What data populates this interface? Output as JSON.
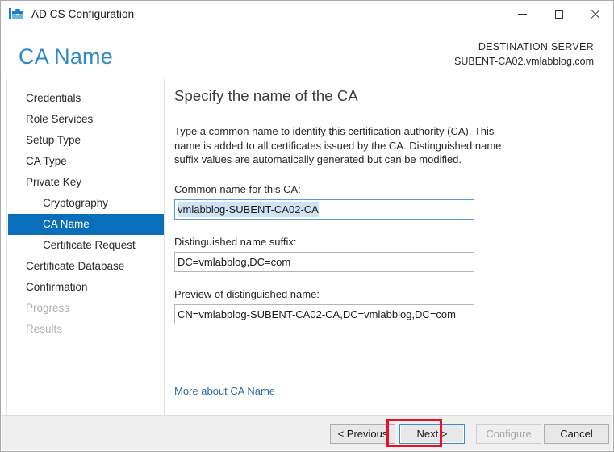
{
  "window": {
    "title": "AD CS Configuration",
    "icon": "server-manager-icon",
    "minimize_label": "Minimize",
    "maximize_label": "Maximize",
    "close_label": "Close"
  },
  "header": {
    "page_title": "CA Name",
    "destination_label": "DESTINATION SERVER",
    "destination_server": "SUBENT-CA02.vmlabblog.com",
    "accent_color": "#2e8bc0"
  },
  "nav": {
    "items": [
      {
        "label": "Credentials",
        "level": 0,
        "state": "enabled"
      },
      {
        "label": "Role Services",
        "level": 0,
        "state": "enabled"
      },
      {
        "label": "Setup Type",
        "level": 0,
        "state": "enabled"
      },
      {
        "label": "CA Type",
        "level": 0,
        "state": "enabled"
      },
      {
        "label": "Private Key",
        "level": 0,
        "state": "enabled"
      },
      {
        "label": "Cryptography",
        "level": 1,
        "state": "enabled"
      },
      {
        "label": "CA Name",
        "level": 1,
        "state": "selected"
      },
      {
        "label": "Certificate Request",
        "level": 1,
        "state": "enabled"
      },
      {
        "label": "Certificate Database",
        "level": 0,
        "state": "enabled"
      },
      {
        "label": "Confirmation",
        "level": 0,
        "state": "enabled"
      },
      {
        "label": "Progress",
        "level": 0,
        "state": "disabled"
      },
      {
        "label": "Results",
        "level": 0,
        "state": "disabled"
      }
    ],
    "selected_color": "#0a6fba"
  },
  "main": {
    "heading": "Specify the name of the CA",
    "paragraph": "Type a common name to identify this certification authority (CA). This name is added to all certificates issued by the CA. Distinguished name suffix values are automatically generated but can be modified.",
    "fields": [
      {
        "label": "Common name for this CA:",
        "value": "vmlabblog-SUBENT-CA02-CA",
        "placeholder": "",
        "focused": true,
        "selected": true
      },
      {
        "label": "Distinguished name suffix:",
        "value": "DC=vmlabblog,DC=com",
        "placeholder": "",
        "focused": false,
        "selected": false
      },
      {
        "label": "Preview of distinguished name:",
        "value": "CN=vmlabblog-SUBENT-CA02-CA,DC=vmlabblog,DC=com",
        "placeholder": "",
        "focused": false,
        "selected": false
      }
    ],
    "more_link": "More about CA Name",
    "link_color": "#2e6da4",
    "selection_color": "#cfe3f7"
  },
  "footer": {
    "previous_label": "< Previous",
    "next_label": "Next >",
    "configure_label": "Configure",
    "cancel_label": "Cancel",
    "next_focused": true,
    "configure_disabled": true,
    "annotation_color": "#e81123"
  }
}
